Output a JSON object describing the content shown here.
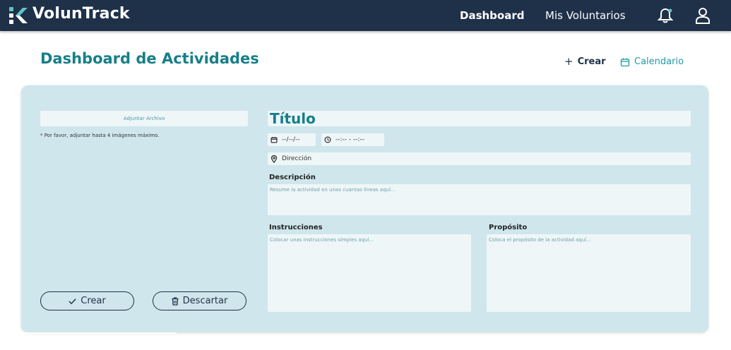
{
  "app": {
    "name": "VolunTrack"
  },
  "nav": {
    "dashboard": "Dashboard",
    "volunteers": "Mis Voluntarios"
  },
  "page": {
    "title": "Dashboard de Actividades"
  },
  "actions": {
    "create": "Crear",
    "calendar": "Calendario"
  },
  "form": {
    "attach_label": "Adjuntar Archivo",
    "attach_note": "* Por favor, adjuntar hasta 4 imágenes máximo.",
    "title_placeholder": "Título",
    "date_placeholder": "--/--/--",
    "time_placeholder": "--:-- - --:--",
    "address_placeholder": "Dirección",
    "description_label": "Descripción",
    "description_placeholder": "Resume la actividad en unas cuantas líneas aquí...",
    "instructions_label": "Instrucciones",
    "instructions_placeholder": "Colocar unas instrucciones simples aquí...",
    "purpose_label": "Propósito",
    "purpose_placeholder": "Coloca el propósito de la actividad aquí...",
    "create_button": "Crear",
    "discard_button": "Descartar"
  },
  "colors": {
    "navbar": "#1f3049",
    "accent": "#167f8a",
    "card": "#cfe6ec",
    "field": "#eef6f7"
  },
  "icons": [
    "logo-icon",
    "bell-icon",
    "user-icon",
    "plus-icon",
    "calendar-icon",
    "clock-icon",
    "location-pin-icon",
    "check-icon",
    "trash-icon"
  ]
}
